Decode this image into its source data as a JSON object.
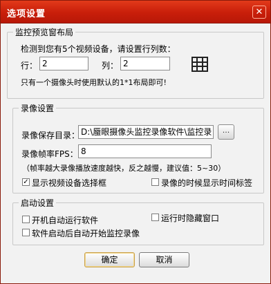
{
  "window": {
    "title": "选项设置",
    "close_label": "✕"
  },
  "preview_layout": {
    "group_title": "监控预览窗布局",
    "detect_text": "检测到您有5个视频设备，请设置行列数：",
    "rows_label": "行：",
    "rows_value": "2",
    "cols_label": "列：",
    "cols_value": "2",
    "note": "只有一个摄像头时使用默认的1*1布局即可!",
    "grid_icon": "grid-layout-icon"
  },
  "recording": {
    "group_title": "录像设置",
    "save_dir_label": "录像保存目录：",
    "save_dir_value": "D:\\蜃眼摄像头监控录像软件\\监控录",
    "browse_label": "...",
    "fps_label": "录像帧率FPS：",
    "fps_value": "8",
    "fps_note": "（帧率越大录像播放速度越快，反之越慢，建议值：5~30）",
    "show_selector_label": "显示视频设备选择框",
    "show_selector_checked": true,
    "show_timestamp_label": "录像的时候显示时间标签",
    "show_timestamp_checked": false
  },
  "startup": {
    "group_title": "启动设置",
    "auto_run_label": "开机自动运行软件",
    "auto_run_checked": false,
    "hide_window_label": "运行时隐藏窗口",
    "hide_window_checked": false,
    "auto_record_label": "软件启动后自动开始监控录像",
    "auto_record_checked": false
  },
  "buttons": {
    "ok_label": "确定",
    "cancel_label": "取消"
  },
  "colors": {
    "titlebar": "#c81e0a",
    "primary_border": "#c9a04c"
  }
}
